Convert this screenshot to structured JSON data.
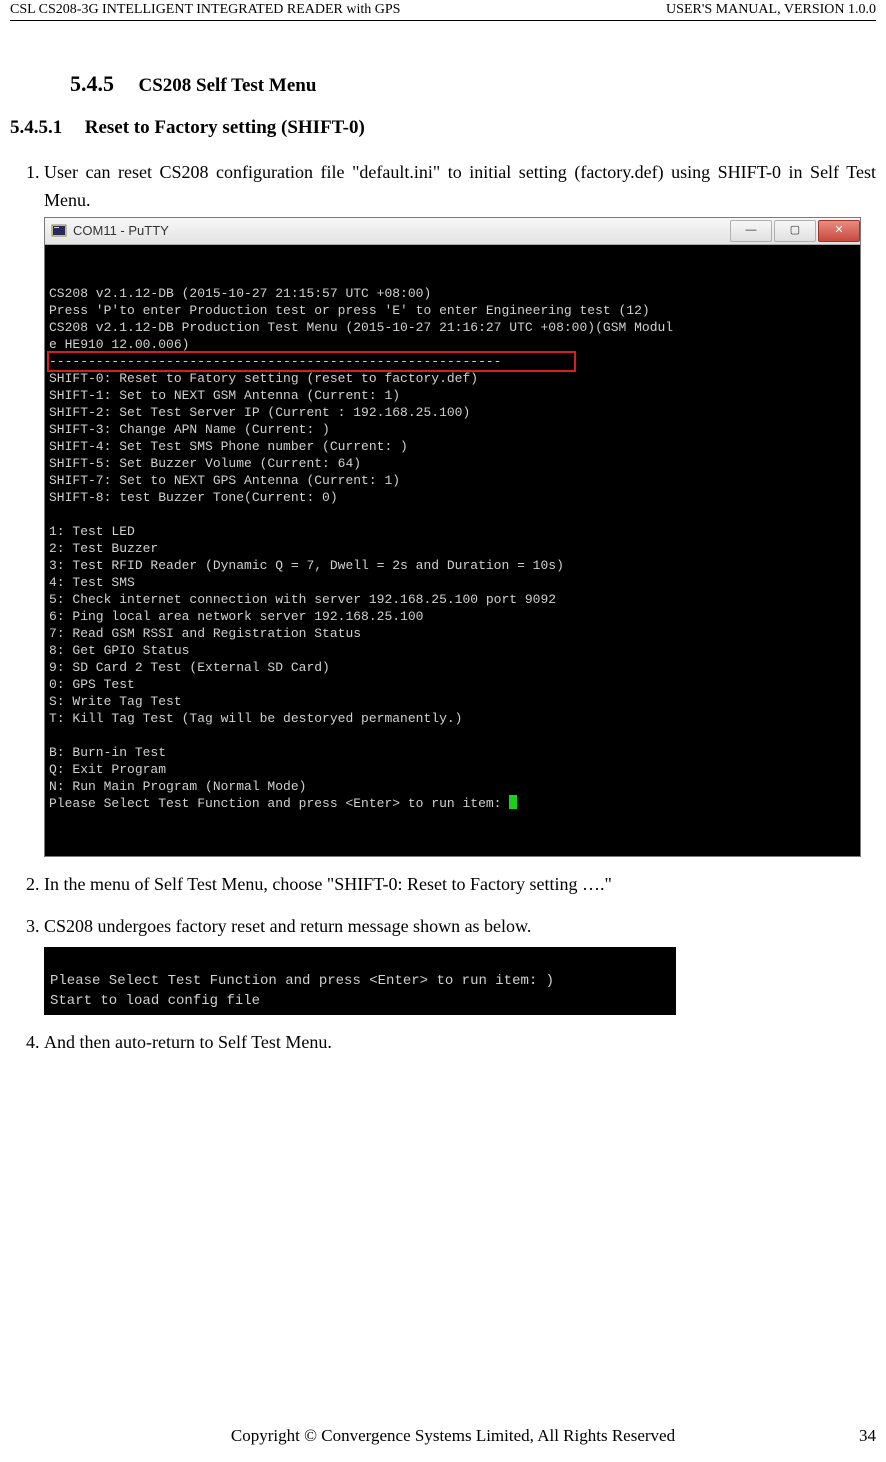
{
  "header": {
    "left": "CSL CS208-3G INTELLIGENT INTEGRATED READER with GPS",
    "right": "USER'S  MANUAL,  VERSION  1.0.0"
  },
  "section": {
    "num": "5.4.5",
    "title": "CS208 Self Test Menu"
  },
  "subsection": {
    "num": "5.4.5.1",
    "title": "Reset to Factory setting (SHIFT-0)"
  },
  "steps": {
    "s1": "User can reset CS208 configuration file \"default.ini\" to initial setting (factory.def) using SHIFT-0 in Self Test Menu.",
    "s2": "In the menu of Self Test Menu, choose \"SHIFT-0: Reset to Factory setting ….\"",
    "s3": "CS208 undergoes factory reset and return message shown as below.",
    "s4": "And then auto-return to Self Test Menu."
  },
  "putty": {
    "title": "COM11 - PuTTY",
    "lines": {
      "l00": "",
      "l01": "CS208 v2.1.12-DB (2015-10-27 21:15:57 UTC +08:00)",
      "l02": "Press 'P'to enter Production test or press 'E' to enter Engineering test (12)",
      "l03": "CS208 v2.1.12-DB Production Test Menu (2015-10-27 21:16:27 UTC +08:00)(GSM Modul",
      "l04": "e HE910 12.00.006)",
      "l05": "----------------------------------------------------------",
      "l06": "SHIFT-0: Reset to Fatory setting (reset to factory.def)",
      "l07": "SHIFT-1: Set to NEXT GSM Antenna (Current: 1)",
      "l08": "SHIFT-2: Set Test Server IP (Current : 192.168.25.100)",
      "l09": "SHIFT-3: Change APN Name (Current: )",
      "l10": "SHIFT-4: Set Test SMS Phone number (Current: )",
      "l11": "SHIFT-5: Set Buzzer Volume (Current: 64)",
      "l12": "SHIFT-7: Set to NEXT GPS Antenna (Current: 1)",
      "l13": "SHIFT-8: test Buzzer Tone(Current: 0)",
      "l14": "",
      "l15": "1: Test LED",
      "l16": "2: Test Buzzer",
      "l17": "3: Test RFID Reader (Dynamic Q = 7, Dwell = 2s and Duration = 10s)",
      "l18": "4: Test SMS",
      "l19": "5: Check internet connection with server 192.168.25.100 port 9092",
      "l20": "6: Ping local area network server 192.168.25.100",
      "l21": "7: Read GSM RSSI and Registration Status",
      "l22": "8: Get GPIO Status",
      "l23": "9: SD Card 2 Test (External SD Card)",
      "l24": "0: GPS Test",
      "l25": "S: Write Tag Test",
      "l26": "T: Kill Tag Test (Tag will be destoryed permanently.)",
      "l27": "",
      "l28": "B: Burn-in Test",
      "l29": "Q: Exit Program",
      "l30": "N: Run Main Program (Normal Mode)",
      "l31": "Please Select Test Function and press <Enter> to run item: "
    }
  },
  "small_terminal": {
    "l1": "Please Select Test Function and press <Enter> to run item: )",
    "l2": "Start to load config file"
  },
  "footer": {
    "center": "Copyright © Convergence Systems Limited, All Rights Reserved",
    "page": "34"
  }
}
